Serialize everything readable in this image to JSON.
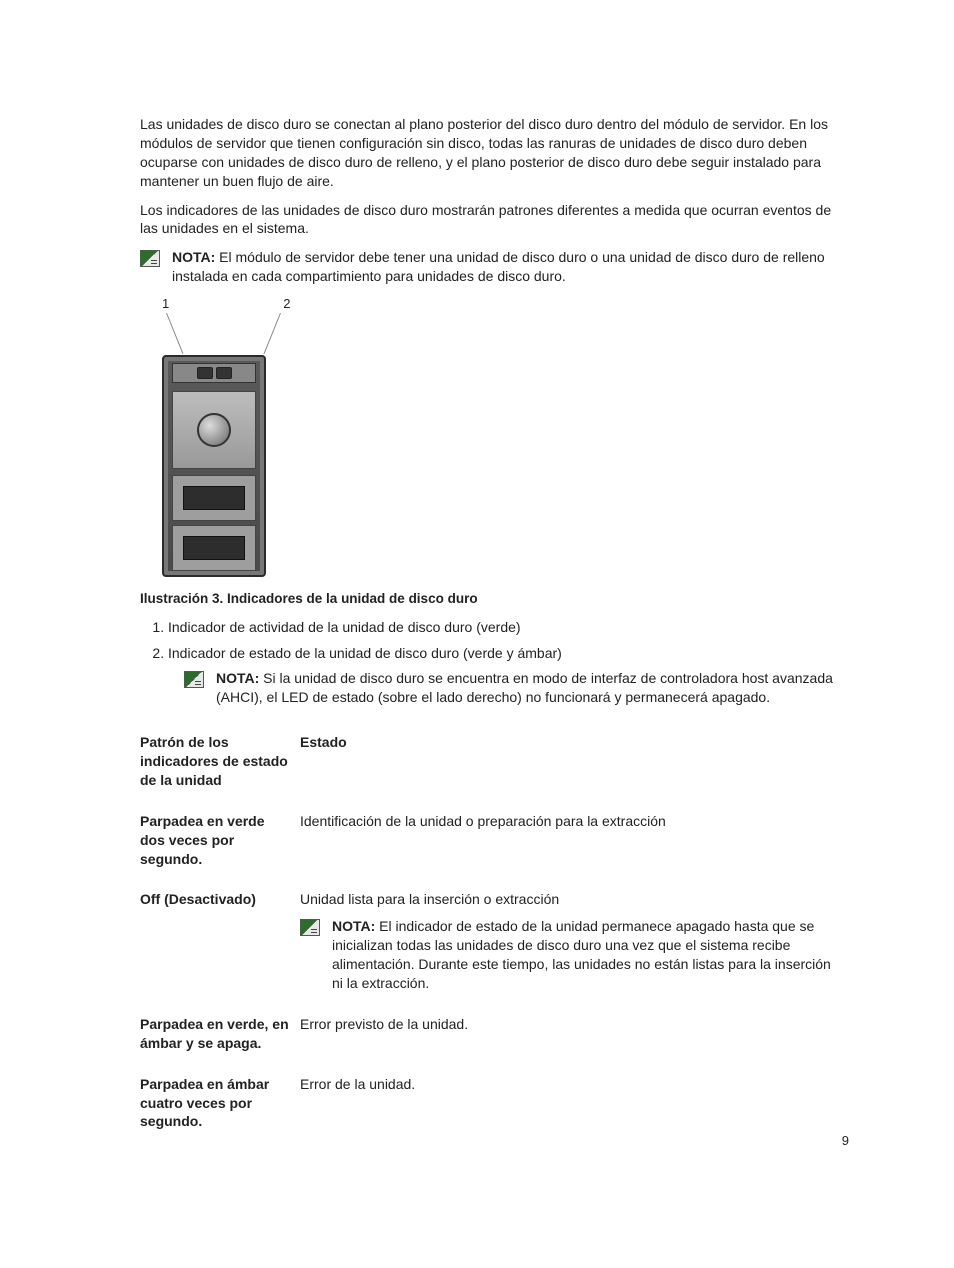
{
  "paragraphs": {
    "p1": "Las unidades de disco duro se conectan al plano posterior del disco duro dentro del módulo de servidor. En los módulos de servidor que tienen configuración sin disco, todas las ranuras de unidades de disco duro deben ocuparse con unidades de disco duro de relleno, y el plano posterior de disco duro debe seguir instalado para mantener un buen flujo de aire.",
    "p2": "Los indicadores de las unidades de disco duro mostrarán patrones diferentes a medida que ocurran eventos de las unidades en el sistema."
  },
  "note1": {
    "label": "NOTA:",
    "text": " El módulo de servidor debe tener una unidad de disco duro o una unidad de disco duro de relleno instalada en cada compartimiento para unidades de disco duro."
  },
  "figure": {
    "callouts": {
      "c1": "1",
      "c2": "2"
    },
    "caption": "Ilustración 3. Indicadores de la unidad de disco duro",
    "legend": {
      "item1": "Indicador de actividad de la unidad de disco duro (verde)",
      "item2": "Indicador de estado de la unidad de disco duro (verde y ámbar)"
    }
  },
  "note2": {
    "label": "NOTA:",
    "text": " Si la unidad de disco duro se encuentra en modo de interfaz de controladora host avanzada (AHCI), el LED de estado (sobre el lado derecho) no funcionará y permanecerá apagado."
  },
  "table": {
    "header": {
      "col1": "Patrón de los indicadores de estado de la unidad",
      "col2": "Estado"
    },
    "rows": [
      {
        "pattern": "Parpadea en verde dos veces por segundo.",
        "state": "Identificación de la unidad o preparación para la extracción"
      },
      {
        "pattern": "Off (Desactivado)",
        "state": "Unidad lista para la inserción o extracción",
        "note": {
          "label": "NOTA:",
          "text": " El indicador de estado de la unidad permanece apagado hasta que se inicializan todas las unidades de disco duro una vez que el sistema recibe alimentación. Durante este tiempo, las unidades no están listas para la inserción ni la extracción."
        }
      },
      {
        "pattern": "Parpadea en verde, en ámbar y se apaga.",
        "state": "Error previsto de la unidad."
      },
      {
        "pattern": "Parpadea en ámbar cuatro veces por segundo.",
        "state": "Error de la unidad."
      }
    ]
  },
  "pageNumber": "9"
}
